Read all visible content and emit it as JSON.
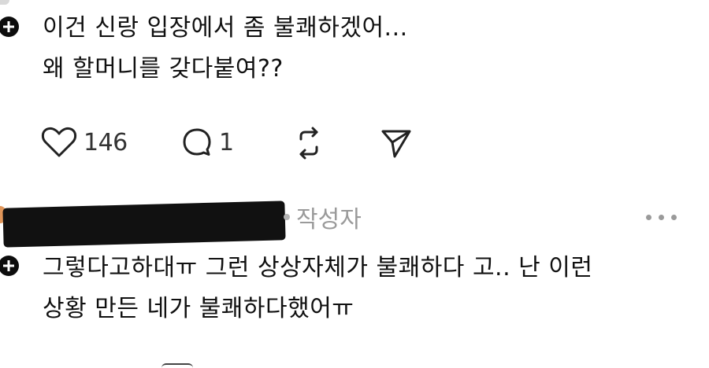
{
  "post1": {
    "lines": [
      "이건 신랑 입장에서  좀 불쾌하겠어...",
      "왜 할머니를 갖다붙여??"
    ],
    "actions": {
      "like_count": "146",
      "reply_count": "1"
    }
  },
  "post2": {
    "author_tag": "작성자",
    "lines": [
      "그렇다고하대ㅠ 그런 상상자체가 불쾌하다 고.. 난 이런",
      "상황 만든 네가 불쾌하다했어ㅠ"
    ]
  },
  "icons": {
    "add": "plus-icon",
    "like": "heart-icon",
    "reply": "comment-bubble-icon",
    "repost": "repost-icon",
    "share": "send-icon",
    "more": "more-dots-icon"
  },
  "colors": {
    "text": "#101010",
    "muted": "#9a9a9a",
    "background": "#ffffff"
  }
}
